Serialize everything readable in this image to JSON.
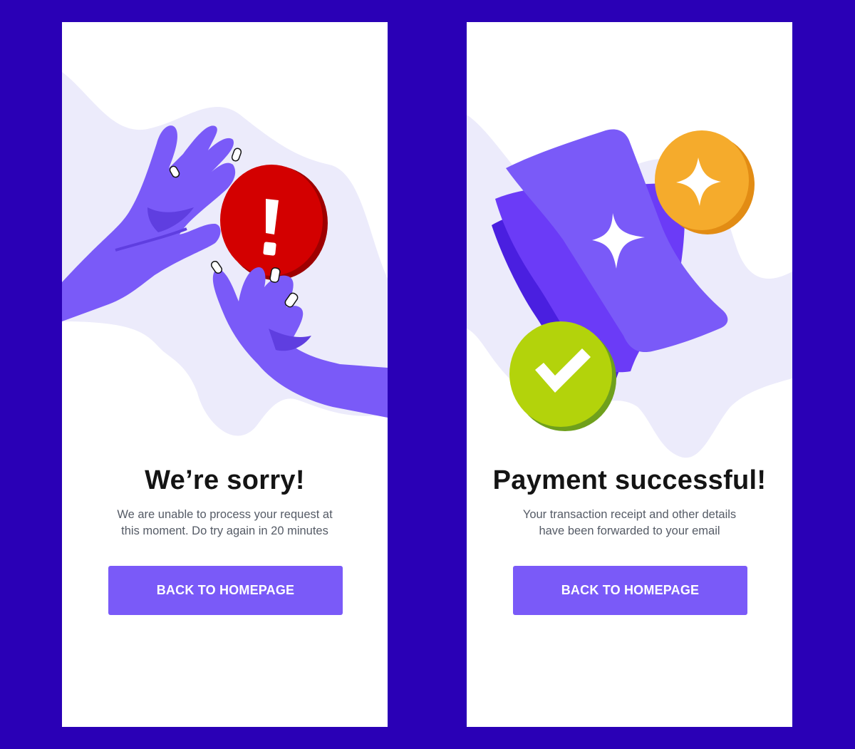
{
  "screens": {
    "error": {
      "title": "We’re sorry!",
      "message_line1": "We are unable to process your request at",
      "message_line2": "this moment. Do try again in 20 minutes",
      "button_label": "BACK TO HOMEPAGE",
      "illustration": "hands-holding-exclamation-coin",
      "icons": [
        "exclamation-icon"
      ]
    },
    "success": {
      "title": "Payment successful!",
      "message_line1": "Your transaction receipt and other details",
      "message_line2": "have been forwarded to your email",
      "button_label": "BACK TO HOMEPAGE",
      "illustration": "receipts-with-coins",
      "icons": [
        "sparkle-icon",
        "checkmark-icon"
      ]
    }
  },
  "colors": {
    "page_background": "#2a00b6",
    "card_background": "#ffffff",
    "accent": "#7a5af8",
    "blob": "#ecebfb",
    "error_red": "#d30000",
    "success_green": "#b3d30b",
    "coin_orange": "#f5ab2c",
    "title_text": "#141414",
    "body_text": "#555b66"
  }
}
